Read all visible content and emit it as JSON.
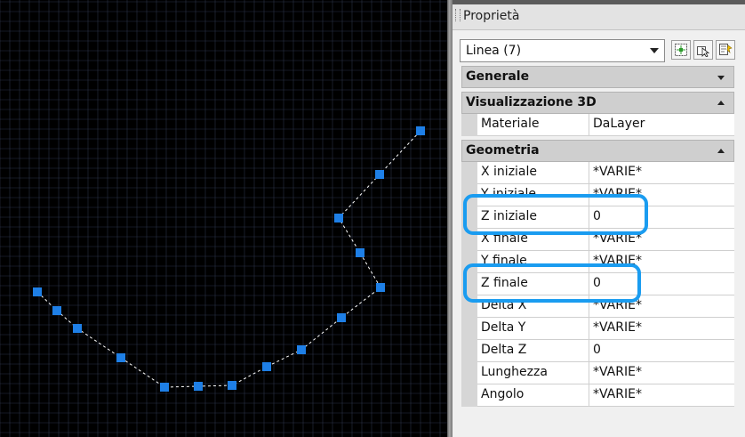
{
  "drawing": {
    "grip_color": "#1e7fe6",
    "line_color": "#ffffff",
    "grid_color": "#2b3246"
  },
  "palette": {
    "title": "Proprietà",
    "selection": "Linea (7)",
    "toolbar_icons": [
      "quick-select-icon",
      "select-objects-icon",
      "toggle-pickadd-icon"
    ],
    "sections": {
      "generale": {
        "label": "Generale",
        "state": "collapsed"
      },
      "vis3d": {
        "label": "Visualizzazione 3D",
        "state": "expanded",
        "rows": [
          {
            "label": "Materiale",
            "value": "DaLayer"
          }
        ]
      },
      "geometria": {
        "label": "Geometria",
        "state": "expanded",
        "rows": [
          {
            "label": "X iniziale",
            "value": "*VARIE*"
          },
          {
            "label": "Y iniziale",
            "value": "*VARIE*"
          },
          {
            "label": "Z iniziale",
            "value": "0"
          },
          {
            "label": "X finale",
            "value": "*VARIE*"
          },
          {
            "label": "Y finale",
            "value": "*VARIE*"
          },
          {
            "label": "Z finale",
            "value": "0"
          },
          {
            "label": "Delta X",
            "value": "*VARIE*"
          },
          {
            "label": "Delta Y",
            "value": "*VARIE*"
          },
          {
            "label": "Delta Z",
            "value": "0"
          },
          {
            "label": "Lunghezza",
            "value": "*VARIE*"
          },
          {
            "label": "Angolo",
            "value": "*VARIE*"
          }
        ]
      }
    },
    "highlight_color": "#1a9cf0"
  }
}
